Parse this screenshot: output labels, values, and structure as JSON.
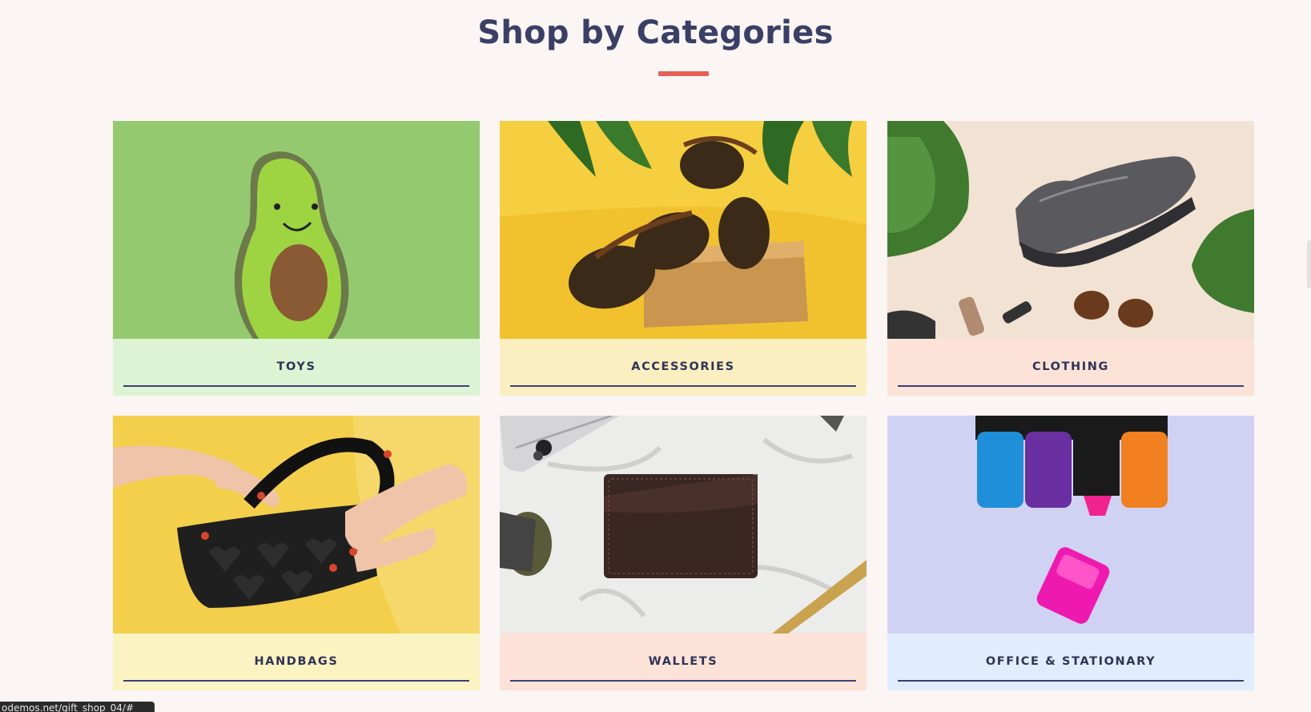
{
  "section": {
    "title": "Shop by Categories",
    "accent_color": "#e65f55",
    "title_color": "#3a3f66"
  },
  "categories": [
    {
      "label": "TOYS",
      "footer_color": "#dcf4d3",
      "image_icon": "avocado-plush-image"
    },
    {
      "label": "ACCESSORIES",
      "footer_color": "#fbefc1",
      "image_icon": "sunglasses-image"
    },
    {
      "label": "CLOTHING",
      "footer_color": "#fde2d8",
      "image_icon": "sneaker-image"
    },
    {
      "label": "HANDBAGS",
      "footer_color": "#fcf3c2",
      "image_icon": "handbag-image"
    },
    {
      "label": "WALLETS",
      "footer_color": "#fde2d8",
      "image_icon": "wallet-image"
    },
    {
      "label": "OFFICE & STATIONARY",
      "footer_color": "#e2ecff",
      "image_icon": "highlighters-image"
    }
  ],
  "status_bar": {
    "url": "odemos.net/gift_shop_04/#"
  }
}
